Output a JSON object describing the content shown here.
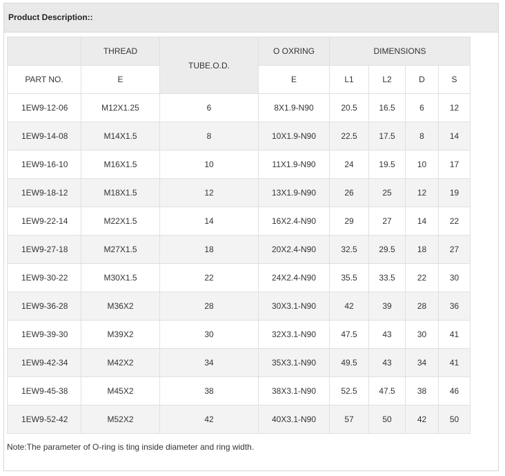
{
  "header": {
    "title": "Product Description::"
  },
  "table": {
    "head_row1": {
      "thread": "THREAD",
      "tube": "TUBE.O.D.",
      "oring": "O OXRING",
      "dimensions": "DIMENSIONS"
    },
    "head_row2": {
      "part": "PART NO.",
      "thread_e": "E",
      "oring_e": "E",
      "l1": "L1",
      "l2": "L2",
      "d": "D",
      "s": "S"
    },
    "rows": [
      [
        "1EW9-12-06",
        "M12X1.25",
        "6",
        "8X1.9-N90",
        "20.5",
        "16.5",
        "6",
        "12"
      ],
      [
        "1EW9-14-08",
        "M14X1.5",
        "8",
        "10X1.9-N90",
        "22.5",
        "17.5",
        "8",
        "14"
      ],
      [
        "1EW9-16-10",
        "M16X1.5",
        "10",
        "11X1.9-N90",
        "24",
        "19.5",
        "10",
        "17"
      ],
      [
        "1EW9-18-12",
        "M18X1.5",
        "12",
        "13X1.9-N90",
        "26",
        "25",
        "12",
        "19"
      ],
      [
        "1EW9-22-14",
        "M22X1.5",
        "14",
        "16X2.4-N90",
        "29",
        "27",
        "14",
        "22"
      ],
      [
        "1EW9-27-18",
        "M27X1.5",
        "18",
        "20X2.4-N90",
        "32.5",
        "29.5",
        "18",
        "27"
      ],
      [
        "1EW9-30-22",
        "M30X1.5",
        "22",
        "24X2.4-N90",
        "35.5",
        "33.5",
        "22",
        "30"
      ],
      [
        "1EW9-36-28",
        "M36X2",
        "28",
        "30X3.1-N90",
        "42",
        "39",
        "28",
        "36"
      ],
      [
        "1EW9-39-30",
        "M39X2",
        "30",
        "32X3.1-N90",
        "47.5",
        "43",
        "30",
        "41"
      ],
      [
        "1EW9-42-34",
        "M42X2",
        "34",
        "35X3.1-N90",
        "49.5",
        "43",
        "34",
        "41"
      ],
      [
        "1EW9-45-38",
        "M45X2",
        "38",
        "38X3.1-N90",
        "52.5",
        "47.5",
        "38",
        "46"
      ],
      [
        "1EW9-52-42",
        "M52X2",
        "42",
        "40X3.1-N90",
        "57",
        "50",
        "42",
        "50"
      ]
    ]
  },
  "note": "Note:The parameter of O-ring is ting inside diameter and ring width."
}
